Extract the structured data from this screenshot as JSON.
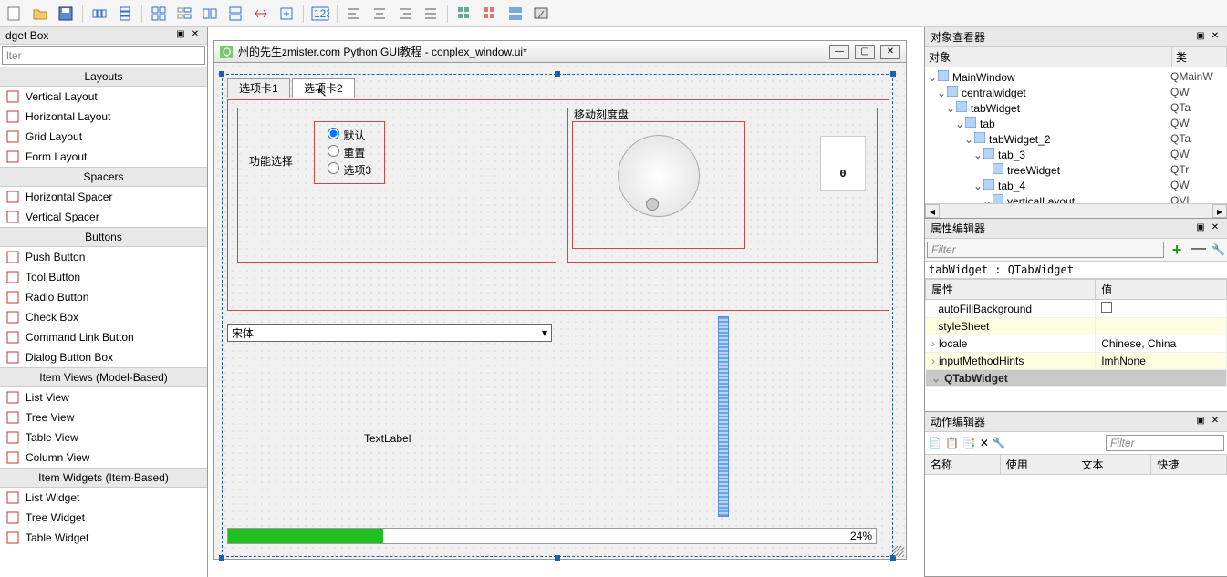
{
  "toolbar_icons": [
    "new",
    "open",
    "save",
    "sep",
    "undo",
    "redo",
    "sep",
    "hlayout",
    "vlayout",
    "grid",
    "form",
    "splith",
    "splitv",
    "break",
    "sep",
    "adjustsize",
    "sep",
    "num",
    "sep",
    "align1",
    "align2",
    "align3",
    "align4",
    "sep",
    "grid1",
    "grid2",
    "grid3",
    "preview"
  ],
  "widget_box": {
    "title": "dget Box",
    "filter_placeholder": "lter",
    "sections": [
      {
        "name": "Layouts",
        "items": [
          "Vertical Layout",
          "Horizontal Layout",
          "Grid Layout",
          "Form Layout"
        ]
      },
      {
        "name": "Spacers",
        "items": [
          "Horizontal Spacer",
          "Vertical Spacer"
        ]
      },
      {
        "name": "Buttons",
        "items": [
          "Push Button",
          "Tool Button",
          "Radio Button",
          "Check Box",
          "Command Link Button",
          "Dialog Button Box"
        ]
      },
      {
        "name": "Item Views (Model-Based)",
        "items": [
          "List View",
          "Tree View",
          "Table View",
          "Column View"
        ]
      },
      {
        "name": "Item Widgets (Item-Based)",
        "items": [
          "List Widget",
          "Tree Widget",
          "Table Widget"
        ]
      }
    ]
  },
  "form": {
    "title": "州的先生zmister.com Python GUI教程 - conplex_window.ui*",
    "tabs": [
      "选项卡1",
      "选项卡2"
    ],
    "active_tab": 1,
    "groupbox_title": "功能选择",
    "radios": [
      "默认",
      "重置",
      "选项3"
    ],
    "radio_checked": 0,
    "dial_title": "移动刻度盘",
    "lcd_value": "0",
    "combo_value": "宋体",
    "text_label": "TextLabel",
    "progress_pct": "24%",
    "progress_val": 24
  },
  "object_inspector": {
    "title": "对象查看器",
    "cols": [
      "对象",
      "类"
    ],
    "tree": [
      {
        "depth": 0,
        "exp": "v",
        "name": "MainWindow",
        "cls": "QMainW"
      },
      {
        "depth": 1,
        "exp": "v",
        "name": "centralwidget",
        "cls": "QW"
      },
      {
        "depth": 2,
        "exp": "v",
        "name": "tabWidget",
        "cls": "QTa"
      },
      {
        "depth": 3,
        "exp": "v",
        "name": "tab",
        "cls": "QW"
      },
      {
        "depth": 4,
        "exp": "v",
        "name": "tabWidget_2",
        "cls": "QTa"
      },
      {
        "depth": 5,
        "exp": "v",
        "name": "tab_3",
        "cls": "QW"
      },
      {
        "depth": 6,
        "exp": "",
        "name": "treeWidget",
        "cls": "QTr"
      },
      {
        "depth": 5,
        "exp": "v",
        "name": "tab_4",
        "cls": "QW"
      },
      {
        "depth": 6,
        "exp": "v",
        "name": "verticalLayout",
        "cls": "QVL"
      }
    ]
  },
  "property_editor": {
    "title": "属性编辑器",
    "filter_placeholder": "Filter",
    "object_line": "tabWidget : QTabWidget",
    "cols": [
      "属性",
      "值"
    ],
    "rows": [
      {
        "name": "autoFillBackground",
        "value": "checkbox",
        "alt": false
      },
      {
        "name": "styleSheet",
        "value": "",
        "alt": true
      },
      {
        "name": "locale",
        "value": "Chinese, China",
        "alt": false,
        "arrow": true
      },
      {
        "name": "inputMethodHints",
        "value": "ImhNone",
        "alt": true,
        "arrow": true
      }
    ],
    "group_row": "QTabWidget"
  },
  "action_editor": {
    "title": "动作编辑器",
    "filter_placeholder": "Filter",
    "cols": [
      "名称",
      "使用",
      "文本",
      "快捷"
    ]
  }
}
